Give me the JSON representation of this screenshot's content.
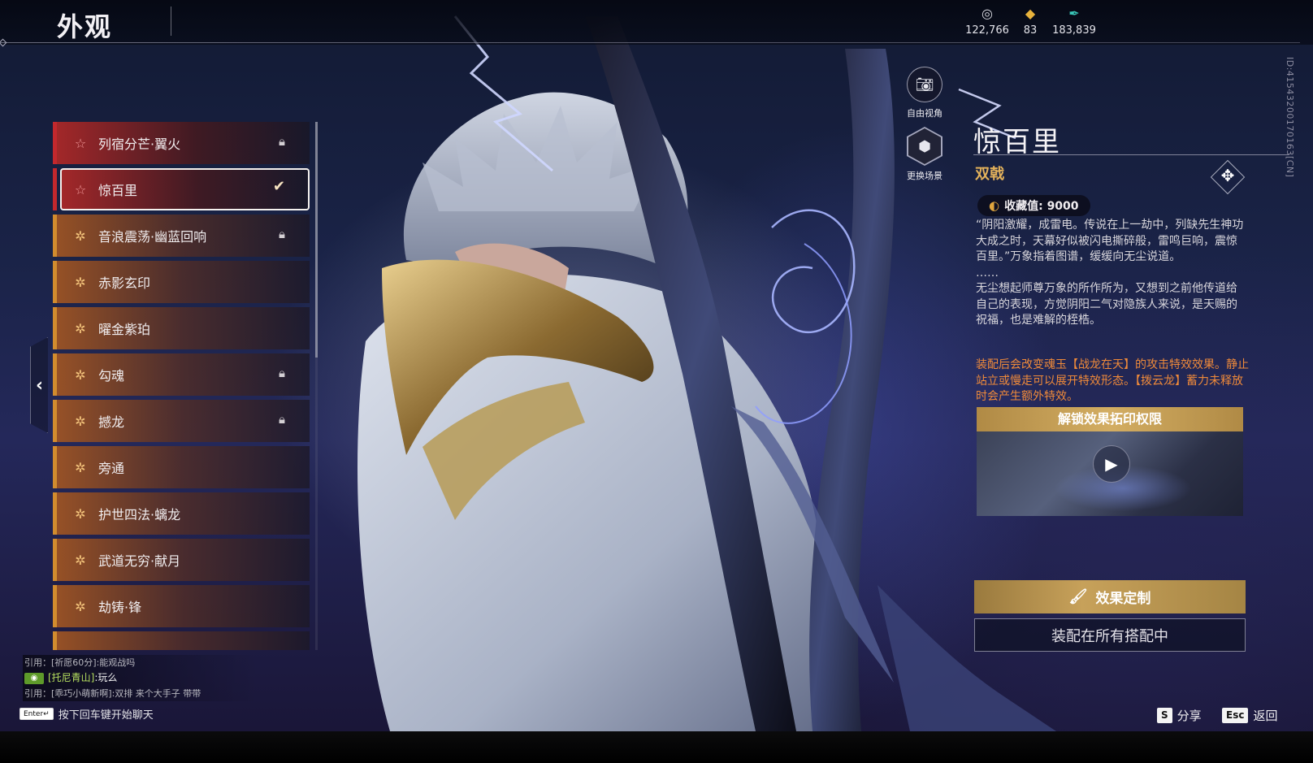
{
  "header": {
    "title": "外观",
    "currencies": [
      {
        "icon": "coin-icon",
        "value": "122,766"
      },
      {
        "icon": "ingot-icon",
        "value": "83"
      },
      {
        "icon": "feather-icon",
        "value": "183,839"
      }
    ]
  },
  "list": {
    "items": [
      {
        "label": "列宿分芒·翼火",
        "rarity": "red",
        "icon": "star-icon",
        "status": "locked"
      },
      {
        "label": "惊百里",
        "rarity": "red",
        "icon": "star-icon",
        "status": "selected"
      },
      {
        "label": "音浪震荡·幽蓝回响",
        "rarity": "gold",
        "icon": "burst-icon",
        "status": "locked"
      },
      {
        "label": "赤影玄印",
        "rarity": "gold",
        "icon": "burst-icon",
        "status": ""
      },
      {
        "label": "曜金紫珀",
        "rarity": "gold",
        "icon": "burst-icon",
        "status": ""
      },
      {
        "label": "勾魂",
        "rarity": "gold",
        "icon": "burst-icon",
        "status": "locked"
      },
      {
        "label": "撼龙",
        "rarity": "gold",
        "icon": "burst-icon",
        "status": "locked"
      },
      {
        "label": "旁通",
        "rarity": "gold",
        "icon": "burst-icon",
        "status": ""
      },
      {
        "label": "护世四法·螭龙",
        "rarity": "gold",
        "icon": "burst-icon",
        "status": ""
      },
      {
        "label": "武道无穷·献月",
        "rarity": "gold",
        "icon": "burst-icon",
        "status": ""
      },
      {
        "label": "劫铸·锋",
        "rarity": "gold",
        "icon": "burst-icon",
        "status": ""
      }
    ]
  },
  "camera": {
    "free_view_label": "自由视角",
    "change_scene_label": "更换场景"
  },
  "detail": {
    "id_text": "ID:4154320017016​3[CN]",
    "name": "惊百里",
    "type": "双戟",
    "collect_label": "收藏值: 9000",
    "description_1": "“阴阳激耀，成雷电。传说在上一劫中，列缺先生神功大成之时，天幕好似被闪电撕碎般，雷鸣巨响，震惊百里。”万象指着图谱，缓缓向无尘说道。",
    "description_ellipsis": "……",
    "description_2": "无尘想起师尊万象的所作所为，又想到之前他传道给自己的表现，方觉阴阳二气对隐族人来说，是天赐的祝福，也是难解的桎梏。",
    "effect_text": "装配后会改变魂玉【战龙在天】的攻击特效效果。静止站立或慢走可以展开特效形态。【拨云龙】蓄力未释放时会产生额外特效。",
    "unlock_banner": "解锁效果拓印权限",
    "custom_button": "效果定制",
    "equip_button": "装配在所有搭配中"
  },
  "chat": {
    "line_1": "引用：[祈愿60分]:能观战吗",
    "line_2_icon": "◉",
    "line_2_name": "[托尼青山]",
    "line_2_text": ":玩么",
    "line_3": "引用：[乖巧小萌新啊]:双排 来个大手子 带带",
    "enter_key": "Enter↵",
    "enter_hint": "按下回车键开始聊天"
  },
  "hotkeys": [
    {
      "key": "S",
      "label": "分享"
    },
    {
      "key": "Esc",
      "label": "返回"
    }
  ],
  "colors": {
    "accent_gold": "#d3ad62",
    "rarity_red": "#c3282d",
    "rarity_gold": "#d28c2e",
    "effect_orange": "#ef8a3a",
    "type_gold": "#e2b15b"
  }
}
